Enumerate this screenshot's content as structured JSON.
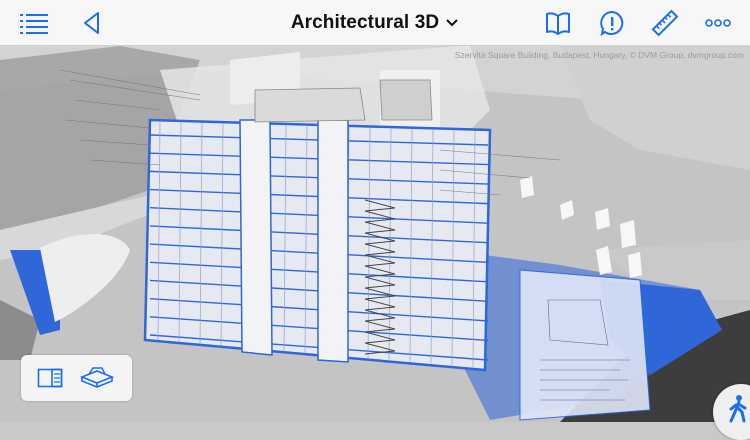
{
  "toolbar": {
    "title": "Architectural 3D",
    "menu_icon": "hamburger-list-icon",
    "back_icon": "back-chevron-icon",
    "book_icon": "open-book-icon",
    "issue_icon": "exclamation-bubble-icon",
    "measure_icon": "ruler-icon",
    "more_icon": "ellipsis-icon"
  },
  "viewport": {
    "credit": "Szervita Square Building, Budapest, Hungary, © DVM Group, dvmgroup.com"
  },
  "view_panel": {
    "sheet_icon": "sheet-view-icon",
    "model_icon": "3d-box-icon"
  },
  "walk": {
    "icon": "pedestrian-walk-icon"
  },
  "colors": {
    "accent": "#1b6ef3",
    "toolbar_bg": "#f7f7f7",
    "model_blue": "#2f66d8",
    "ground_gray": "#bdbdbd",
    "dark_gray": "#3d3d3d"
  }
}
